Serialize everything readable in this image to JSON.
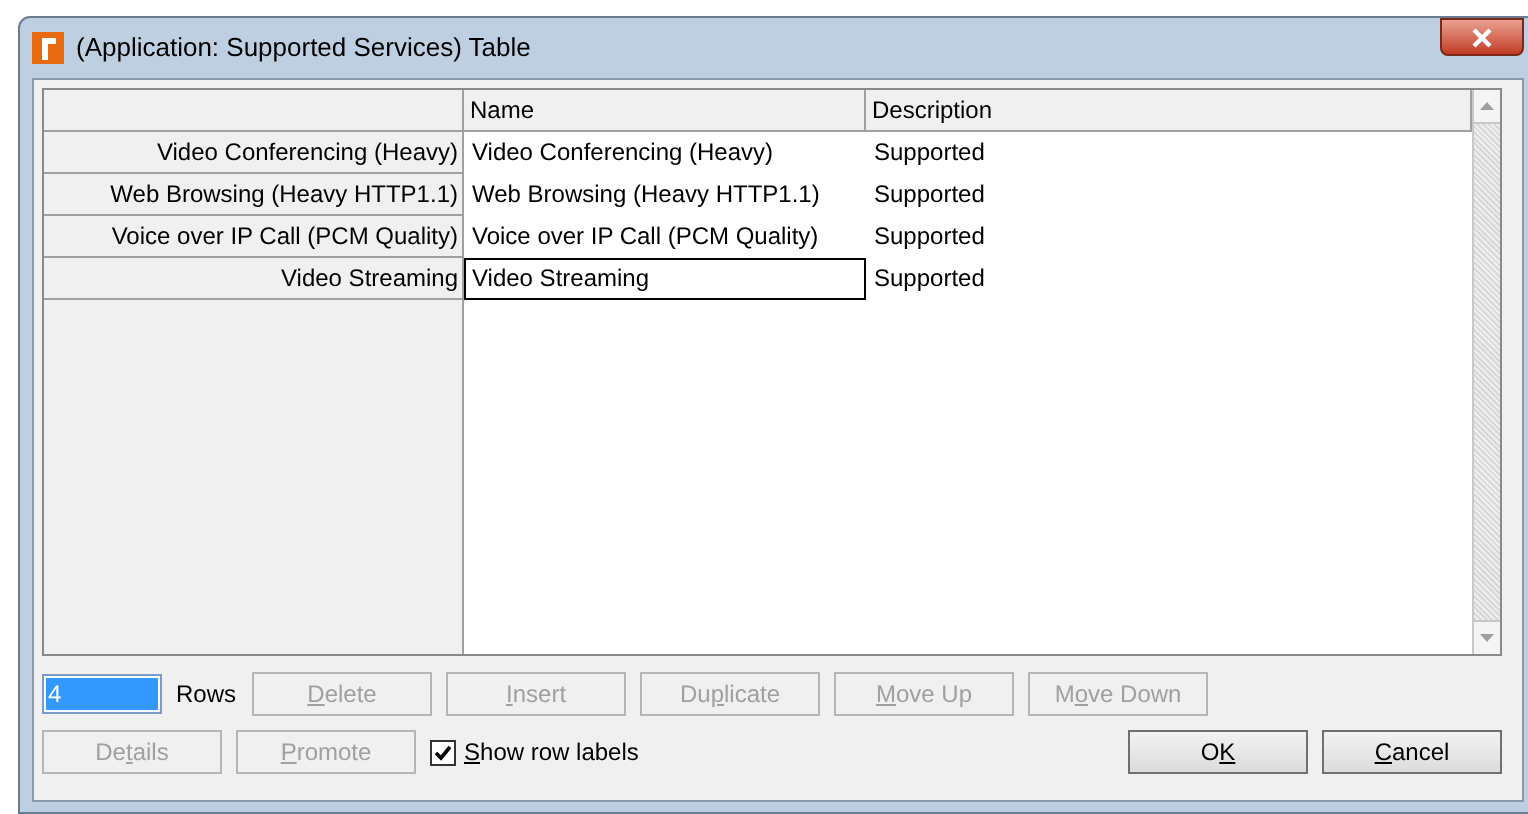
{
  "window": {
    "title": "(Application: Supported Services) Table"
  },
  "table": {
    "columns": [
      "Name",
      "Description"
    ],
    "rows": [
      {
        "label": "Video Conferencing (Heavy)",
        "cells": [
          "Video Conferencing (Heavy)",
          "Supported"
        ],
        "focused": false
      },
      {
        "label": "Web Browsing (Heavy HTTP1.1)",
        "cells": [
          "Web Browsing (Heavy HTTP1.1)",
          "Supported"
        ],
        "focused": false
      },
      {
        "label": "Voice over IP Call (PCM Quality)",
        "cells": [
          "Voice over IP Call (PCM Quality)",
          "Supported"
        ],
        "focused": false
      },
      {
        "label": "Video Streaming",
        "cells": [
          "Video Streaming",
          "Supported"
        ],
        "focused": true
      }
    ]
  },
  "rows_field": {
    "value": "4",
    "label": "Rows"
  },
  "row_buttons": [
    {
      "access_key": "D",
      "post": "elete",
      "disabled": true
    },
    {
      "access_key": "I",
      "post": "nsert",
      "disabled": true
    },
    {
      "pre": "Du",
      "access_key": "p",
      "post": "licate",
      "disabled": true
    },
    {
      "access_key": "M",
      "post": "ove Up",
      "disabled": true
    },
    {
      "pre": "M",
      "access_key": "o",
      "post": "ve Down",
      "disabled": true
    }
  ],
  "left_buttons": [
    {
      "pre": "De",
      "access_key": "t",
      "post": "ails",
      "disabled": true
    },
    {
      "access_key": "P",
      "post": "romote",
      "disabled": true
    }
  ],
  "show_row_labels": {
    "access_key": "S",
    "post": "how row labels",
    "checked": true
  },
  "dialog_buttons": [
    {
      "pre": "O",
      "access_key": "K",
      "disabled": false
    },
    {
      "access_key": "C",
      "post": "ancel",
      "disabled": false
    }
  ]
}
